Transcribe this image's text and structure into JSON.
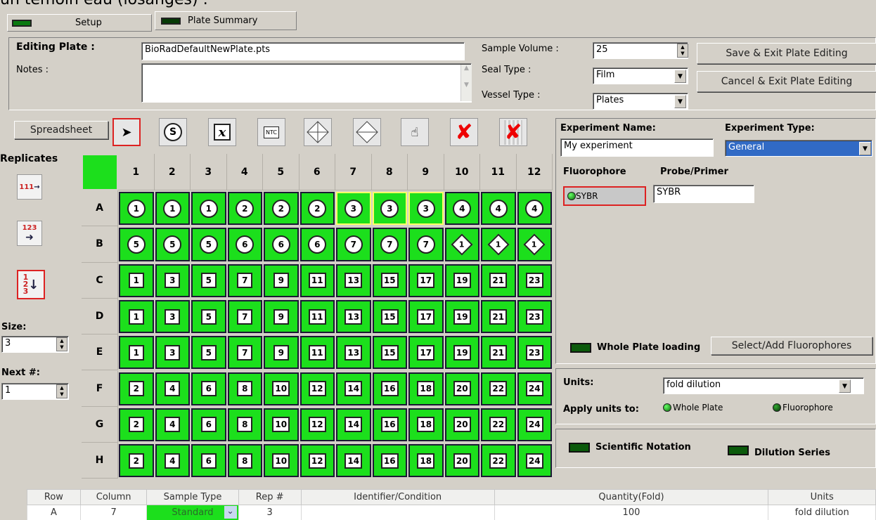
{
  "caption": "un témoin eau (losanges) :",
  "tabs": {
    "setup": "Setup",
    "plate_summary": "Plate Summary"
  },
  "editing": {
    "label": "Editing Plate :",
    "file": "BioRadDefaultNewPlate.pts",
    "notes_label": "Notes :",
    "sample_volume_label": "Sample Volume :",
    "sample_volume": "25",
    "seal_type_label": "Seal Type :",
    "seal_type": "Film",
    "vessel_type_label": "Vessel Type :",
    "vessel_type": "Plates",
    "save_btn": "Save & Exit Plate Editing",
    "cancel_btn": "Cancel & Exit Plate Editing"
  },
  "toolbar": {
    "spreadsheet": "Spreadsheet",
    "standard": "S",
    "unknown": "x",
    "ntc": "NTC"
  },
  "replicates": {
    "title": "Replicates",
    "size_label": "Size:",
    "size": "3",
    "next_label": "Next #:",
    "next": "1"
  },
  "plate": {
    "columns": [
      "1",
      "2",
      "3",
      "4",
      "5",
      "6",
      "7",
      "8",
      "9",
      "10",
      "11",
      "12"
    ],
    "rows": [
      {
        "label": "A",
        "cells": [
          {
            "t": "c",
            "v": "1"
          },
          {
            "t": "c",
            "v": "1"
          },
          {
            "t": "c",
            "v": "1"
          },
          {
            "t": "c",
            "v": "2"
          },
          {
            "t": "c",
            "v": "2"
          },
          {
            "t": "c",
            "v": "2"
          },
          {
            "t": "c",
            "v": "3",
            "hl": true
          },
          {
            "t": "c",
            "v": "3",
            "hl": true
          },
          {
            "t": "c",
            "v": "3",
            "hl": true
          },
          {
            "t": "c",
            "v": "4"
          },
          {
            "t": "c",
            "v": "4"
          },
          {
            "t": "c",
            "v": "4"
          }
        ]
      },
      {
        "label": "B",
        "cells": [
          {
            "t": "c",
            "v": "5"
          },
          {
            "t": "c",
            "v": "5"
          },
          {
            "t": "c",
            "v": "5"
          },
          {
            "t": "c",
            "v": "6"
          },
          {
            "t": "c",
            "v": "6"
          },
          {
            "t": "c",
            "v": "6"
          },
          {
            "t": "c",
            "v": "7"
          },
          {
            "t": "c",
            "v": "7"
          },
          {
            "t": "c",
            "v": "7"
          },
          {
            "t": "d",
            "v": "1"
          },
          {
            "t": "d",
            "v": "1"
          },
          {
            "t": "d",
            "v": "1"
          }
        ]
      },
      {
        "label": "C",
        "cells": [
          {
            "t": "s",
            "v": "1"
          },
          {
            "t": "s",
            "v": "3"
          },
          {
            "t": "s",
            "v": "5"
          },
          {
            "t": "s",
            "v": "7"
          },
          {
            "t": "s",
            "v": "9"
          },
          {
            "t": "s",
            "v": "11"
          },
          {
            "t": "s",
            "v": "13"
          },
          {
            "t": "s",
            "v": "15"
          },
          {
            "t": "s",
            "v": "17"
          },
          {
            "t": "s",
            "v": "19"
          },
          {
            "t": "s",
            "v": "21"
          },
          {
            "t": "s",
            "v": "23"
          }
        ]
      },
      {
        "label": "D",
        "cells": [
          {
            "t": "s",
            "v": "1"
          },
          {
            "t": "s",
            "v": "3"
          },
          {
            "t": "s",
            "v": "5"
          },
          {
            "t": "s",
            "v": "7"
          },
          {
            "t": "s",
            "v": "9"
          },
          {
            "t": "s",
            "v": "11"
          },
          {
            "t": "s",
            "v": "13"
          },
          {
            "t": "s",
            "v": "15"
          },
          {
            "t": "s",
            "v": "17"
          },
          {
            "t": "s",
            "v": "19"
          },
          {
            "t": "s",
            "v": "21"
          },
          {
            "t": "s",
            "v": "23"
          }
        ]
      },
      {
        "label": "E",
        "cells": [
          {
            "t": "s",
            "v": "1"
          },
          {
            "t": "s",
            "v": "3"
          },
          {
            "t": "s",
            "v": "5"
          },
          {
            "t": "s",
            "v": "7"
          },
          {
            "t": "s",
            "v": "9"
          },
          {
            "t": "s",
            "v": "11"
          },
          {
            "t": "s",
            "v": "13"
          },
          {
            "t": "s",
            "v": "15"
          },
          {
            "t": "s",
            "v": "17"
          },
          {
            "t": "s",
            "v": "19"
          },
          {
            "t": "s",
            "v": "21"
          },
          {
            "t": "s",
            "v": "23"
          }
        ]
      },
      {
        "label": "F",
        "cells": [
          {
            "t": "s",
            "v": "2"
          },
          {
            "t": "s",
            "v": "4"
          },
          {
            "t": "s",
            "v": "6"
          },
          {
            "t": "s",
            "v": "8"
          },
          {
            "t": "s",
            "v": "10"
          },
          {
            "t": "s",
            "v": "12"
          },
          {
            "t": "s",
            "v": "14"
          },
          {
            "t": "s",
            "v": "16"
          },
          {
            "t": "s",
            "v": "18"
          },
          {
            "t": "s",
            "v": "20"
          },
          {
            "t": "s",
            "v": "22"
          },
          {
            "t": "s",
            "v": "24"
          }
        ]
      },
      {
        "label": "G",
        "cells": [
          {
            "t": "s",
            "v": "2"
          },
          {
            "t": "s",
            "v": "4"
          },
          {
            "t": "s",
            "v": "6"
          },
          {
            "t": "s",
            "v": "8"
          },
          {
            "t": "s",
            "v": "10"
          },
          {
            "t": "s",
            "v": "12"
          },
          {
            "t": "s",
            "v": "14"
          },
          {
            "t": "s",
            "v": "16"
          },
          {
            "t": "s",
            "v": "18"
          },
          {
            "t": "s",
            "v": "20"
          },
          {
            "t": "s",
            "v": "22"
          },
          {
            "t": "s",
            "v": "24"
          }
        ]
      },
      {
        "label": "H",
        "cells": [
          {
            "t": "s",
            "v": "2"
          },
          {
            "t": "s",
            "v": "4"
          },
          {
            "t": "s",
            "v": "6"
          },
          {
            "t": "s",
            "v": "8"
          },
          {
            "t": "s",
            "v": "10"
          },
          {
            "t": "s",
            "v": "12"
          },
          {
            "t": "s",
            "v": "14"
          },
          {
            "t": "s",
            "v": "16"
          },
          {
            "t": "s",
            "v": "18"
          },
          {
            "t": "s",
            "v": "20"
          },
          {
            "t": "s",
            "v": "22"
          },
          {
            "t": "s",
            "v": "24"
          }
        ]
      }
    ]
  },
  "experiment": {
    "name_label": "Experiment Name:",
    "name": "My experiment",
    "type_label": "Experiment Type:",
    "type": "General",
    "fluorophore_label": "Fluorophore",
    "probe_label": "Probe/Primer",
    "fluorophore": "SYBR",
    "probe": "SYBR",
    "whole_plate_loading": "Whole Plate loading",
    "select_add_fluor": "Select/Add Fluorophores"
  },
  "units": {
    "label": "Units:",
    "value": "fold dilution",
    "apply_label": "Apply units to:",
    "whole_plate": "Whole Plate",
    "fluorophore": "Fluorophore",
    "scientific_notation": "Scientific Notation",
    "dilution_series": "Dilution Series"
  },
  "table": {
    "headers": [
      "Row",
      "Column",
      "Sample Type",
      "Rep #",
      "Identifier/Condition",
      "Quantity(Fold)",
      "Units"
    ],
    "rows": [
      {
        "row": "A",
        "column": "7",
        "sample_type": "Standard",
        "rep": "3",
        "identifier": "",
        "quantity": "100",
        "units": "fold dilution"
      }
    ]
  },
  "colors": {
    "well_green": "#1cdf1c",
    "accent_blue": "#316ac5",
    "selected_red": "#d22222"
  }
}
